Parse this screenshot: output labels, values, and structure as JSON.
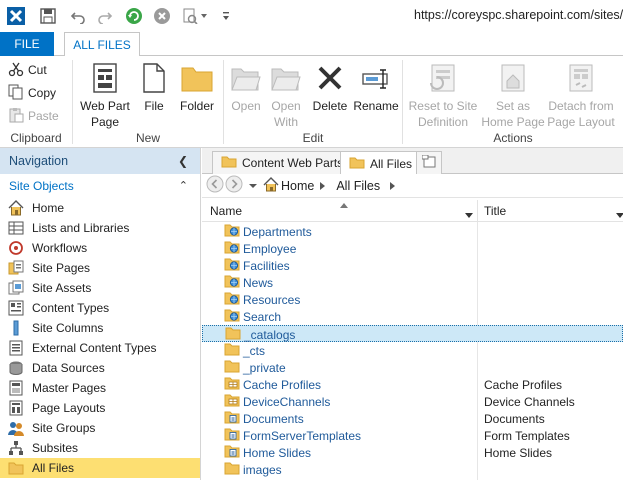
{
  "qat": {
    "url": "https://coreyspc.sharepoint.com/sites/"
  },
  "tabs": {
    "file": "FILE",
    "all_files": "ALL FILES"
  },
  "ribbon": {
    "clipboard": {
      "label": "Clipboard",
      "cut": "Cut",
      "copy": "Copy",
      "paste": "Paste"
    },
    "new": {
      "label": "New",
      "web_part_page_1": "Web Part",
      "web_part_page_2": "Page",
      "file": "File",
      "folder": "Folder"
    },
    "edit": {
      "label": "Edit",
      "open": "Open",
      "open_with_1": "Open",
      "open_with_2": "With",
      "delete": "Delete",
      "rename": "Rename"
    },
    "actions": {
      "label": "Actions",
      "reset_1": "Reset to Site",
      "reset_2": "Definition",
      "homepage_1": "Set as",
      "homepage_2": "Home Page",
      "detach_1": "Detach from",
      "detach_2": "Page Layout"
    }
  },
  "nav": {
    "heading": "Navigation",
    "section": "Site Objects",
    "items": [
      {
        "label": "Home",
        "icon": "home-icon"
      },
      {
        "label": "Lists and Libraries",
        "icon": "list-icon"
      },
      {
        "label": "Workflows",
        "icon": "workflow-icon"
      },
      {
        "label": "Site Pages",
        "icon": "site-pages-icon"
      },
      {
        "label": "Site Assets",
        "icon": "site-assets-icon"
      },
      {
        "label": "Content Types",
        "icon": "content-types-icon"
      },
      {
        "label": "Site Columns",
        "icon": "site-columns-icon"
      },
      {
        "label": "External Content Types",
        "icon": "external-content-types-icon"
      },
      {
        "label": "Data Sources",
        "icon": "data-sources-icon"
      },
      {
        "label": "Master Pages",
        "icon": "master-pages-icon"
      },
      {
        "label": "Page Layouts",
        "icon": "page-layouts-icon"
      },
      {
        "label": "Site Groups",
        "icon": "site-groups-icon"
      },
      {
        "label": "Subsites",
        "icon": "subsites-icon"
      },
      {
        "label": "All Files",
        "icon": "folder-icon",
        "selected": true
      }
    ]
  },
  "main": {
    "tabs": [
      {
        "label": "Content Web Parts"
      },
      {
        "label": "All Files"
      }
    ],
    "breadcrumb": {
      "home": "Home",
      "all_files": "All Files"
    },
    "columns": {
      "name": "Name",
      "title": "Title"
    },
    "rows": [
      {
        "name": "Departments",
        "title": "",
        "icon": "globe-folder-icon"
      },
      {
        "name": "Employee",
        "title": "",
        "icon": "globe-folder-icon"
      },
      {
        "name": "Facilities",
        "title": "",
        "icon": "globe-folder-icon"
      },
      {
        "name": "News",
        "title": "",
        "icon": "globe-folder-icon"
      },
      {
        "name": "Resources",
        "title": "",
        "icon": "globe-folder-icon"
      },
      {
        "name": "Search",
        "title": "",
        "icon": "globe-folder-icon"
      },
      {
        "name": "_catalogs",
        "title": "",
        "icon": "folder-icon",
        "selected": true
      },
      {
        "name": "_cts",
        "title": "",
        "icon": "folder-icon"
      },
      {
        "name": "_private",
        "title": "",
        "icon": "folder-icon"
      },
      {
        "name": "Cache Profiles",
        "title": "Cache Profiles",
        "icon": "list-folder-icon"
      },
      {
        "name": "DeviceChannels",
        "title": "Device Channels",
        "icon": "list-folder-icon"
      },
      {
        "name": "Documents",
        "title": "Documents",
        "icon": "library-folder-icon"
      },
      {
        "name": "FormServerTemplates",
        "title": "Form Templates",
        "icon": "library-folder-icon"
      },
      {
        "name": "Home Slides",
        "title": "Home Slides",
        "icon": "library-folder-icon"
      },
      {
        "name": "images",
        "title": "",
        "icon": "folder-icon"
      }
    ]
  },
  "colors": {
    "accent": "#0072c6",
    "nav_header": "#d5e4f2",
    "nav_selected": "#fddf72",
    "row_selected": "#cde8f7",
    "folder": "#f1c35a"
  }
}
